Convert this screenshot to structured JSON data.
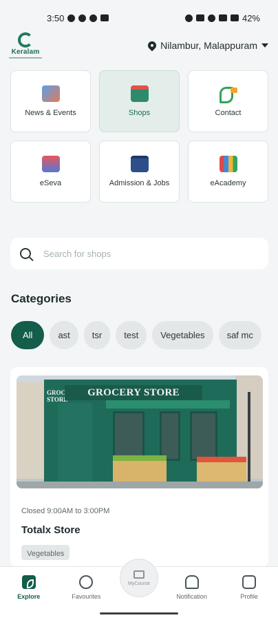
{
  "status_bar": {
    "time": "3:50",
    "battery": "42%"
  },
  "header": {
    "logo_text": "Keralam",
    "location": "Nilambur, Malappuram"
  },
  "tiles": [
    {
      "label": "News & Events",
      "icon": "news-icon"
    },
    {
      "label": "Shops",
      "icon": "shop-icon",
      "active": true
    },
    {
      "label": "Contact",
      "icon": "phone-icon"
    },
    {
      "label": "eSeva",
      "icon": "eseva-icon"
    },
    {
      "label": "Admission & Jobs",
      "icon": "briefcase-icon"
    },
    {
      "label": "eAcademy",
      "icon": "books-icon"
    }
  ],
  "search": {
    "placeholder": "Search for shops"
  },
  "categories": {
    "title": "Categories",
    "chips": [
      "All",
      "ast",
      "tsr",
      "test",
      "Vegetables",
      "saf mc"
    ],
    "selected": "All"
  },
  "store_card": {
    "image_sign": "GROCERY STORE",
    "image_side_sign": "GROCERY STORE",
    "hours": "Closed 9:00AM to 3:00PM",
    "name": "Totalx Store",
    "tag": "Vegetables"
  },
  "bottom_nav": {
    "items": [
      {
        "label": "Explore",
        "active": true
      },
      {
        "label": "Favourites"
      },
      {
        "label": "MyCourse"
      },
      {
        "label": "Notification"
      },
      {
        "label": "Profile"
      }
    ]
  },
  "colors": {
    "primary": "#135d4a",
    "accent": "#1f6b52",
    "background": "#f3f5f6"
  }
}
